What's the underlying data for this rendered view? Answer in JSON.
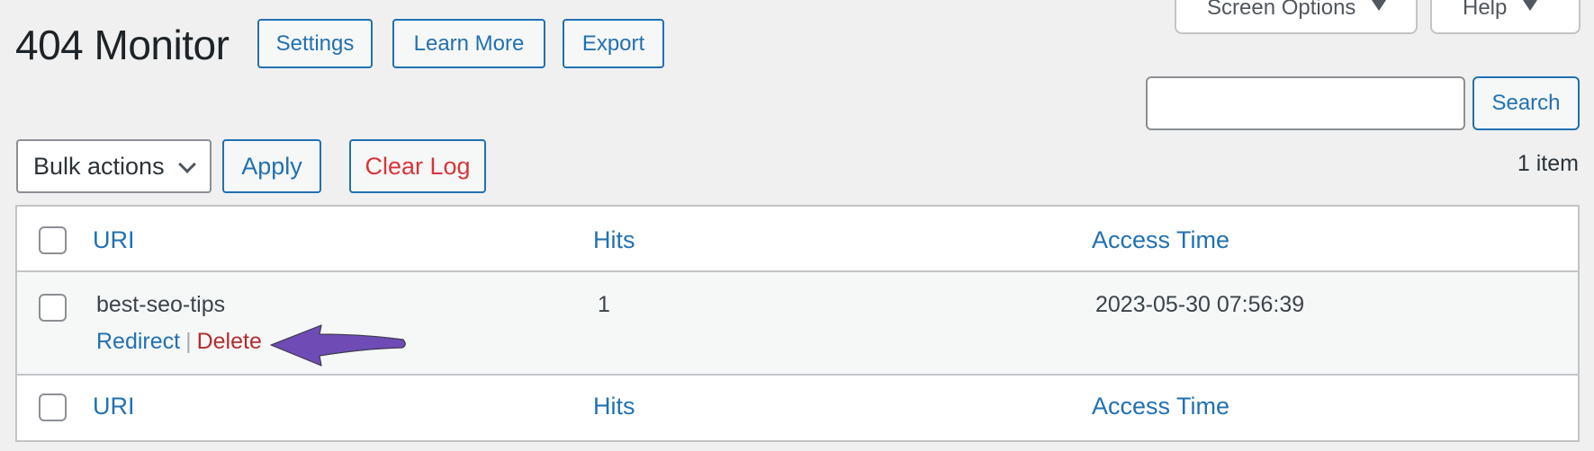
{
  "header": {
    "title": "404 Monitor",
    "buttons": {
      "settings": "Settings",
      "learn_more": "Learn More",
      "export": "Export"
    }
  },
  "screen_meta": {
    "screen_options": "Screen Options",
    "help": "Help"
  },
  "search": {
    "value": "",
    "placeholder": "",
    "button": "Search"
  },
  "tablenav": {
    "bulk_actions": "Bulk actions",
    "apply": "Apply",
    "clear_log": "Clear Log",
    "item_count": "1 item"
  },
  "table": {
    "columns": [
      "URI",
      "Hits",
      "Access Time"
    ],
    "rows": [
      {
        "uri": "best-seo-tips",
        "hits": "1",
        "access_time": "2023-05-30 07:56:39",
        "actions": {
          "redirect": "Redirect",
          "separator": "|",
          "delete": "Delete"
        }
      }
    ]
  },
  "annotation": {
    "arrow_color": "#6f4bb6",
    "points_to": "Delete"
  },
  "colors": {
    "accent": "#2271b1",
    "danger": "#d63638",
    "delete_link": "#b32d2e",
    "background": "#f0f0f1"
  }
}
